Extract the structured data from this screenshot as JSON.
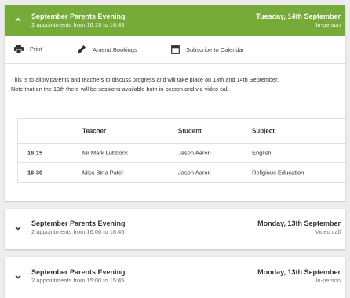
{
  "events": [
    {
      "title": "September Parents Evening",
      "subtitle": "2 appointments from 16:15 to 16:45",
      "date": "Tuesday, 14th September",
      "mode": "In-person",
      "expanded": true,
      "toolbar": {
        "print_label": "Print",
        "amend_label": "Amend Bookings",
        "subscribe_label": "Subscribe to Calendar"
      },
      "description_line1": "This is to allow parents and teachers to discuss progress and will take place on 13th and 14th September.",
      "description_line2": "Note that on the 13th there will be sessions available both in-person and via video call.",
      "table": {
        "headers": [
          "",
          "Teacher",
          "Student",
          "Subject"
        ],
        "rows": [
          [
            "16:15",
            "Mr Mark Lubbock",
            "Jason Aaron",
            "English"
          ],
          [
            "16:30",
            "Miss Bina Patel",
            "Jason Aaron",
            "Religious Education"
          ]
        ]
      }
    },
    {
      "title": "September Parents Evening",
      "subtitle": "2 appointments from 16:00 to 16:45",
      "date": "Monday, 13th September",
      "mode": "Video call",
      "expanded": false
    },
    {
      "title": "September Parents Evening",
      "subtitle": "2 appointments from 15:00 to 15:45",
      "date": "Monday, 13th September",
      "mode": "In-person",
      "expanded": false
    }
  ],
  "colors": {
    "header_green": "#76ab3a",
    "background": "#ededed"
  },
  "icons": {
    "collapse": "chevron-up-icon",
    "expand": "chevron-down-icon",
    "print": "printer-icon",
    "amend": "pencil-icon",
    "subscribe": "calendar-icon"
  }
}
